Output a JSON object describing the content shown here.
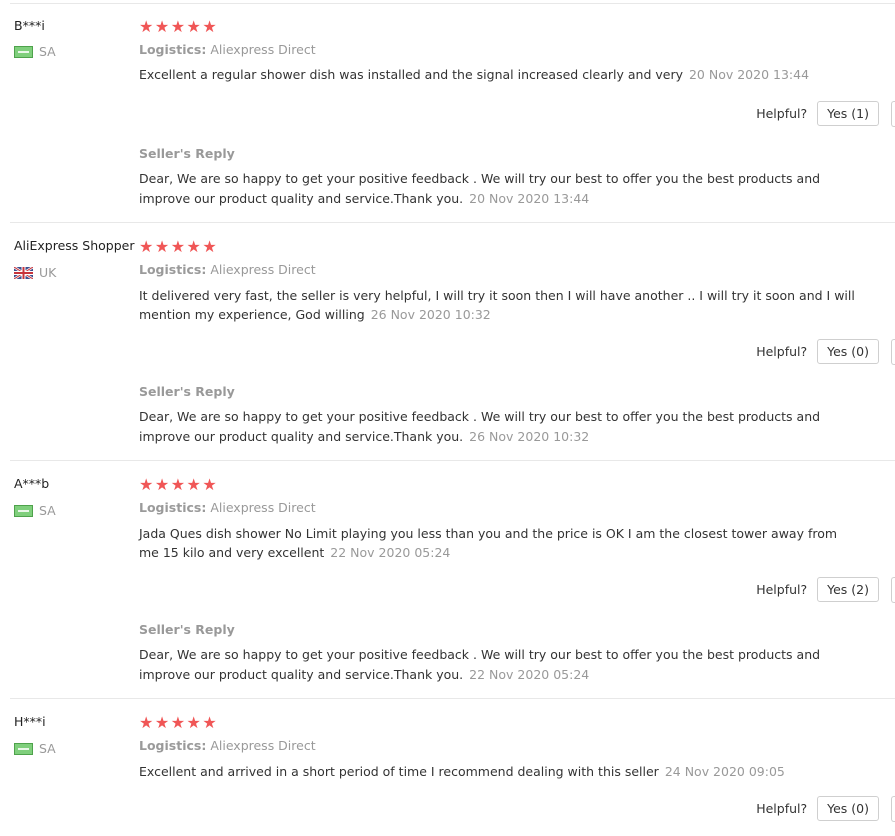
{
  "labels": {
    "logistics": "Logistics:",
    "helpful": "Helpful?",
    "seller_reply": "Seller's Reply"
  },
  "colors": {
    "star": "#f05656",
    "muted": "#999999"
  },
  "reviews": [
    {
      "name": "B***i",
      "country": "SA",
      "flag_icon": "sa-flag-icon",
      "stars": "★★★★★",
      "rating": 5,
      "logistics": "Aliexpress Direct",
      "text": "Excellent a regular shower dish was installed and the signal increased clearly and very",
      "date": "20 Nov 2020 13:44",
      "yes": "Yes (1)",
      "reply": "Dear, We are so happy to get your positive feedback . We will try our best to offer you the best products and improve our product quality and service.Thank you.",
      "reply_date": "20 Nov 2020 13:44"
    },
    {
      "name": "AliExpress Shopper",
      "country": "UK",
      "flag_icon": "uk-flag-icon",
      "stars": "★★★★★",
      "rating": 5,
      "logistics": "Aliexpress Direct",
      "text": "It delivered very fast, the seller is very helpful, I will try it soon then I will have another .. I will try it soon and I will mention my experience, God willing",
      "date": "26 Nov 2020 10:32",
      "yes": "Yes (0)",
      "reply": "Dear, We are so happy to get your positive feedback . We will try our best to offer you the best products and improve our product quality and service.Thank you.",
      "reply_date": "26 Nov 2020 10:32"
    },
    {
      "name": "A***b",
      "country": "SA",
      "flag_icon": "sa-flag-icon",
      "stars": "★★★★★",
      "rating": 5,
      "logistics": "Aliexpress Direct",
      "text": "Jada Ques dish shower No Limit playing you less than you and the price is OK I am the closest tower away from me 15 kilo and very excellent",
      "date": "22 Nov 2020 05:24",
      "yes": "Yes (2)",
      "reply": "Dear, We are so happy to get your positive feedback . We will try our best to offer you the best products and improve our product quality and service.Thank you.",
      "reply_date": "22 Nov 2020 05:24"
    },
    {
      "name": "H***i",
      "country": "SA",
      "flag_icon": "sa-flag-icon",
      "stars": "★★★★★",
      "rating": 5,
      "logistics": "Aliexpress Direct",
      "text": "Excellent and arrived in a short period of time I recommend dealing with this seller",
      "date": "24 Nov 2020 09:05",
      "yes": "Yes (0)"
    }
  ]
}
